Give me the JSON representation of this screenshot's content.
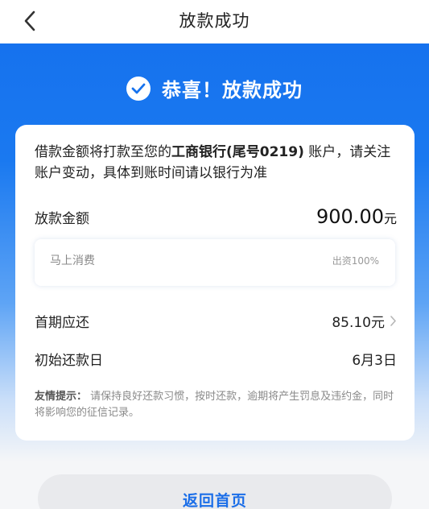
{
  "nav": {
    "back_icon": "chevron-left-icon",
    "title": "放款成功"
  },
  "hero": {
    "check_icon": "check-circle-icon",
    "title": "恭喜！放款成功"
  },
  "card": {
    "notice_prefix": "借款金额将打款至您的",
    "notice_bank": "工商银行(尾号0219)",
    "notice_suffix": "账户，请关注账户变动，具体到账时间请以银行为准",
    "amount": {
      "label": "放款金额",
      "value": "900.00",
      "unit": "元"
    },
    "lender": {
      "name": "马上消费",
      "share": "出资100%"
    },
    "first_payment": {
      "label": "首期应还",
      "value": "85.10元"
    },
    "first_due_date": {
      "label": "初始还款日",
      "value": "6月3日"
    },
    "tip_label": "友情提示：",
    "tip_text": "请保持良好还款习惯，按时还款，逾期将产生罚息及违约金，同时将影响您的征信记录。"
  },
  "footer": {
    "home_button": "返回首页"
  },
  "colors": {
    "brand_blue": "#1672ee",
    "button_text": "#1b6ee8"
  }
}
